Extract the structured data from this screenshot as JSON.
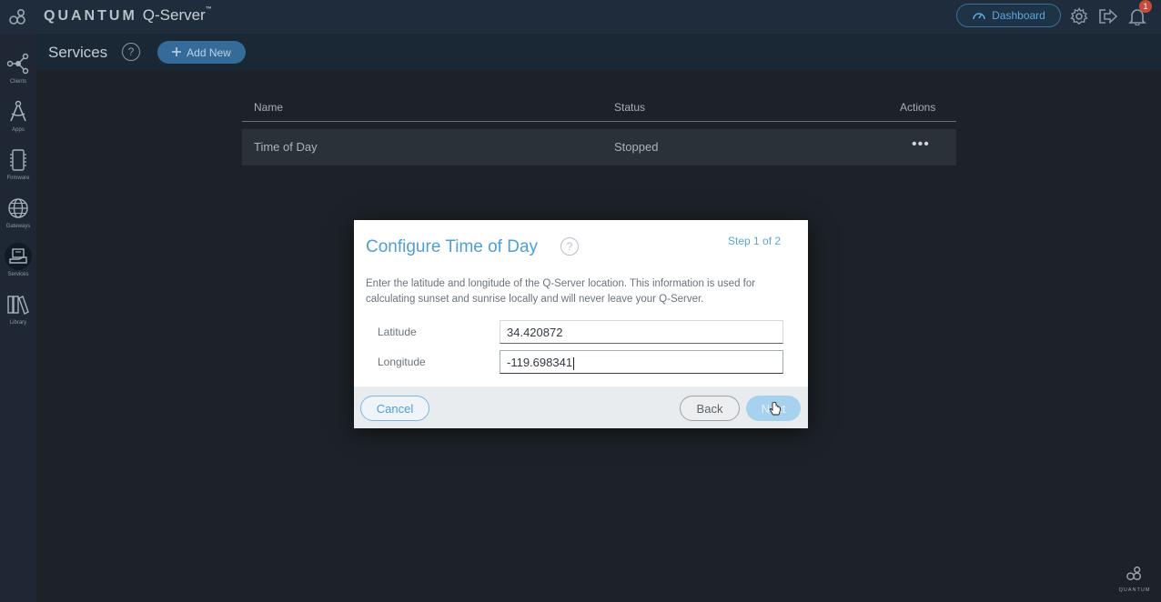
{
  "topbar": {
    "brand_name": "QUANTUM",
    "product_name": "Q-Server",
    "trademark": "™",
    "dashboard_label": "Dashboard",
    "notification_count": "1"
  },
  "sidebar": {
    "items": [
      {
        "label": "Clients",
        "icon": "clients-icon"
      },
      {
        "label": "Apps",
        "icon": "apps-icon"
      },
      {
        "label": "Firmware",
        "icon": "firmware-icon"
      },
      {
        "label": "Gateways",
        "icon": "gateways-icon"
      },
      {
        "label": "Services",
        "icon": "services-icon",
        "active": true
      },
      {
        "label": "Library",
        "icon": "library-icon"
      }
    ]
  },
  "subheader": {
    "title": "Services",
    "help": "?",
    "add_new_label": "Add New"
  },
  "table": {
    "columns": [
      "Name",
      "Status",
      "Actions"
    ],
    "rows": [
      {
        "name": "Time of Day",
        "status": "Stopped",
        "actions": "•••"
      }
    ]
  },
  "modal": {
    "title": "Configure Time of Day",
    "help": "?",
    "step": "Step 1 of 2",
    "description": "Enter the latitude and longitude of the Q-Server location. This information is used for calculating sunset and sunrise locally and will never leave your Q-Server.",
    "latitude_label": "Latitude",
    "latitude_value": "34.420872",
    "longitude_label": "Longitude",
    "longitude_value": "-119.698341",
    "cancel_label": "Cancel",
    "back_label": "Back",
    "next_label": "Next"
  },
  "footer_logo": {
    "text": "QUANTUM"
  },
  "colors": {
    "accent": "#4d9fd6",
    "topbar": "#1e2c3c",
    "sidebar": "#1e2733",
    "background": "#1c2228",
    "badge": "#c64b3b"
  }
}
